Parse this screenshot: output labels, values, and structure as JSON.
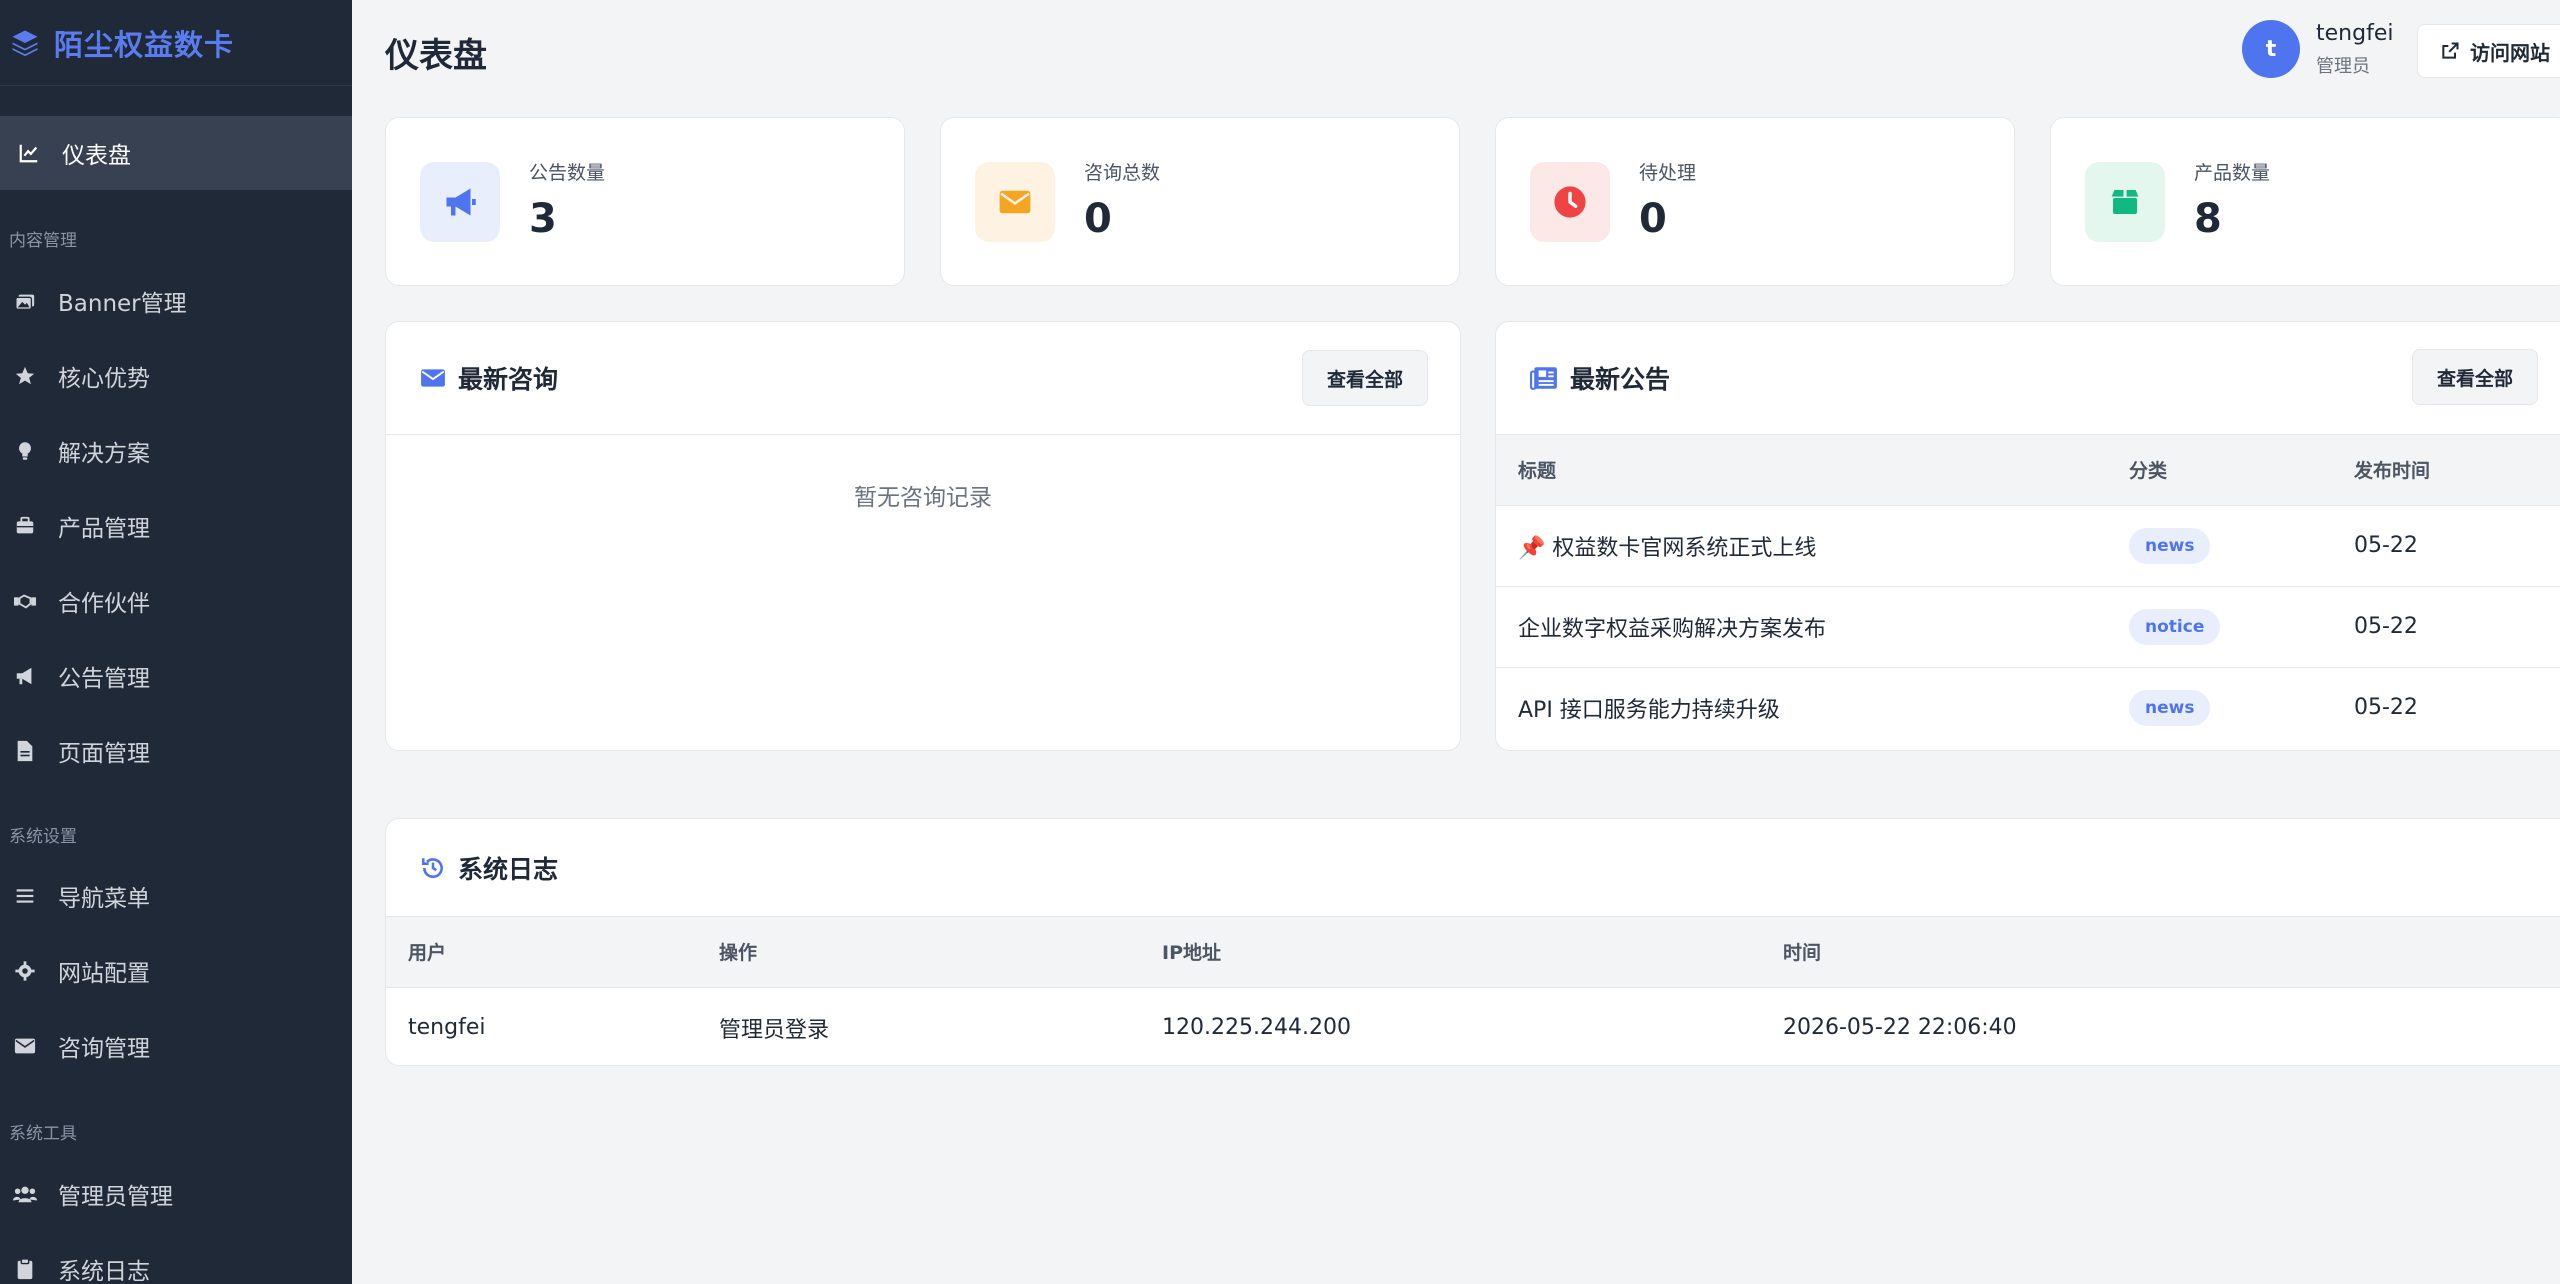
{
  "brand": {
    "name": "陌尘权益数卡",
    "icon": "layers-icon"
  },
  "sidebar": {
    "sections": {
      "content": "内容管理",
      "system": "系统设置",
      "tools": "系统工具"
    },
    "items": [
      {
        "label": "仪表盘",
        "icon": "chart-line-icon",
        "active": true
      },
      {
        "label": "Banner管理",
        "icon": "images-icon"
      },
      {
        "label": "核心优势",
        "icon": "star-icon"
      },
      {
        "label": "解决方案",
        "icon": "lightbulb-icon"
      },
      {
        "label": "产品管理",
        "icon": "briefcase-icon"
      },
      {
        "label": "合作伙伴",
        "icon": "handshake-icon"
      },
      {
        "label": "公告管理",
        "icon": "megaphone-icon"
      },
      {
        "label": "页面管理",
        "icon": "file-icon"
      },
      {
        "label": "导航菜单",
        "icon": "bars-icon"
      },
      {
        "label": "网站配置",
        "icon": "gear-icon"
      },
      {
        "label": "咨询管理",
        "icon": "envelope-icon"
      },
      {
        "label": "管理员管理",
        "icon": "users-icon"
      },
      {
        "label": "系统日志",
        "icon": "clipboard-icon"
      }
    ]
  },
  "header": {
    "title": "仪表盘",
    "user": {
      "avatar_letter": "t",
      "name": "tengfei",
      "role": "管理员"
    },
    "visit_label": "访问网站"
  },
  "stats": [
    {
      "label": "公告数量",
      "value": "3",
      "icon": "megaphone-icon",
      "color": "#4f74f0",
      "bg": "#e8eefc"
    },
    {
      "label": "咨询总数",
      "value": "0",
      "icon": "envelope-icon",
      "color": "#f5a524",
      "bg": "#fef3e2"
    },
    {
      "label": "待处理",
      "value": "0",
      "icon": "clock-icon",
      "color": "#ef4444",
      "bg": "#fde8e8"
    },
    {
      "label": "产品数量",
      "value": "8",
      "icon": "box-icon",
      "color": "#10b981",
      "bg": "#e3f7ef"
    }
  ],
  "inquiries": {
    "title": "最新咨询",
    "view_all": "查看全部",
    "empty": "暂无咨询记录"
  },
  "announcements": {
    "title": "最新公告",
    "view_all": "查看全部",
    "columns": [
      "标题",
      "分类",
      "发布时间"
    ],
    "rows": [
      {
        "pinned": "📌",
        "title": "权益数卡官网系统正式上线",
        "category": "news",
        "date": "05-22"
      },
      {
        "pinned": "",
        "title": "企业数字权益采购解决方案发布",
        "category": "notice",
        "date": "05-22"
      },
      {
        "pinned": "",
        "title": "API 接口服务能力持续升级",
        "category": "news",
        "date": "05-22"
      }
    ]
  },
  "logs": {
    "title": "系统日志",
    "columns": [
      "用户",
      "操作",
      "IP地址",
      "时间"
    ],
    "rows": [
      {
        "user": "tengfei",
        "action": "管理员登录",
        "ip": "120.225.244.200",
        "time": "2026-05-22 22:06:40"
      }
    ]
  }
}
